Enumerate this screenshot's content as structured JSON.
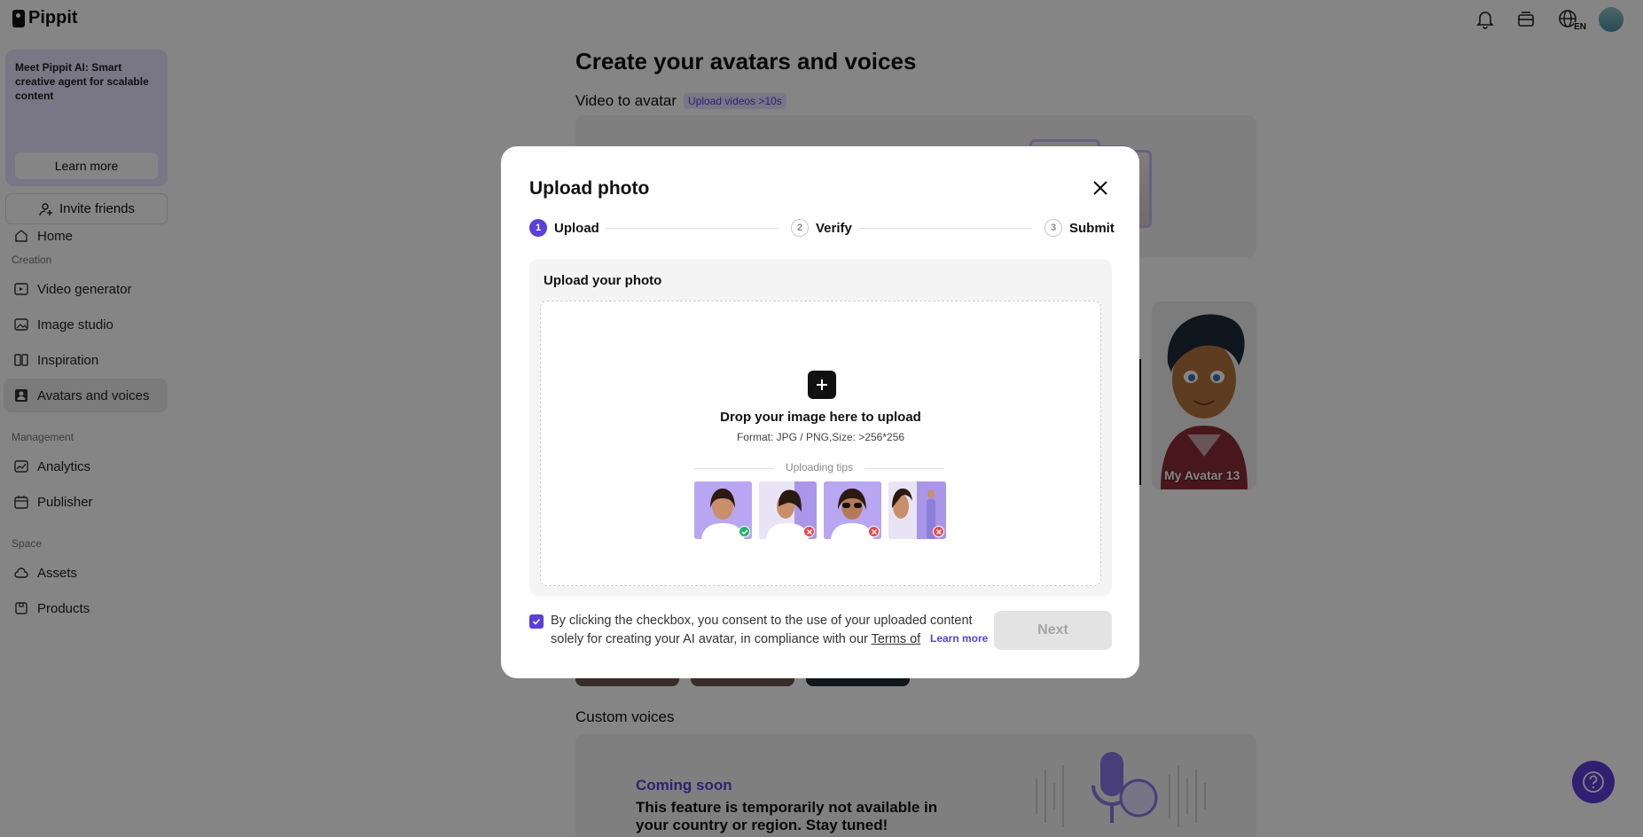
{
  "app": {
    "name": "Pippit"
  },
  "topbar": {
    "icons": [
      "bell-icon",
      "layers-icon",
      "globe-language-icon",
      "user-avatar"
    ],
    "language_badge": "EN"
  },
  "sidebar": {
    "promo": {
      "text": "Meet Pippit AI: Smart creative agent for scalable content",
      "button": "Learn more"
    },
    "invite_label": "Invite friends",
    "home_label": "Home",
    "sections": {
      "creation": "Creation",
      "management": "Management",
      "space": "Space"
    },
    "creation_items": [
      {
        "label": "Video generator",
        "icon": "video-plus-icon"
      },
      {
        "label": "Image studio",
        "icon": "image-edit-icon"
      },
      {
        "label": "Inspiration",
        "icon": "inspiration-icon"
      },
      {
        "label": "Avatars and voices",
        "icon": "avatar-icon",
        "active": true
      }
    ],
    "management_items": [
      {
        "label": "Analytics",
        "icon": "chart-icon"
      },
      {
        "label": "Publisher",
        "icon": "calendar-icon"
      }
    ],
    "space_items": [
      {
        "label": "Assets",
        "icon": "cloud-icon"
      },
      {
        "label": "Products",
        "icon": "box-icon"
      }
    ]
  },
  "main": {
    "title": "Create your avatars and voices",
    "video_to_avatar": {
      "label": "Video to avatar",
      "badge": "Upload videos >10s"
    },
    "avatar_card_label": "My Avatar 13",
    "custom_voices": {
      "title": "Custom voices",
      "status": "Coming soon",
      "message": "This feature is temporarily not available in your country or region. Stay tuned!"
    }
  },
  "modal": {
    "title": "Upload photo",
    "steps": [
      {
        "num": "1",
        "label": "Upload",
        "active": true
      },
      {
        "num": "2",
        "label": "Verify",
        "active": false
      },
      {
        "num": "3",
        "label": "Submit",
        "active": false
      }
    ],
    "upload_section_label": "Upload your photo",
    "drop_title": "Drop your image here to upload",
    "drop_format": "Format: JPG / PNG,Size: >256*256",
    "tips_label": "Uploading tips",
    "tips": [
      {
        "name": "front-facing",
        "status": "ok"
      },
      {
        "name": "side-profile",
        "status": "bad"
      },
      {
        "name": "sunglasses",
        "status": "bad"
      },
      {
        "name": "full-body",
        "status": "bad"
      }
    ],
    "consent_line1": "By clicking the checkbox, you consent to the use of your uploaded content",
    "consent_line2_prefix": "solely for creating your AI avatar, in compliance with our ",
    "consent_terms": "Terms of",
    "learn_more": "Learn more",
    "consent_checked": true,
    "next_label": "Next"
  },
  "colors": {
    "accent": "#5a3fd8",
    "ok": "#23b36a",
    "bad": "#e5484d"
  }
}
